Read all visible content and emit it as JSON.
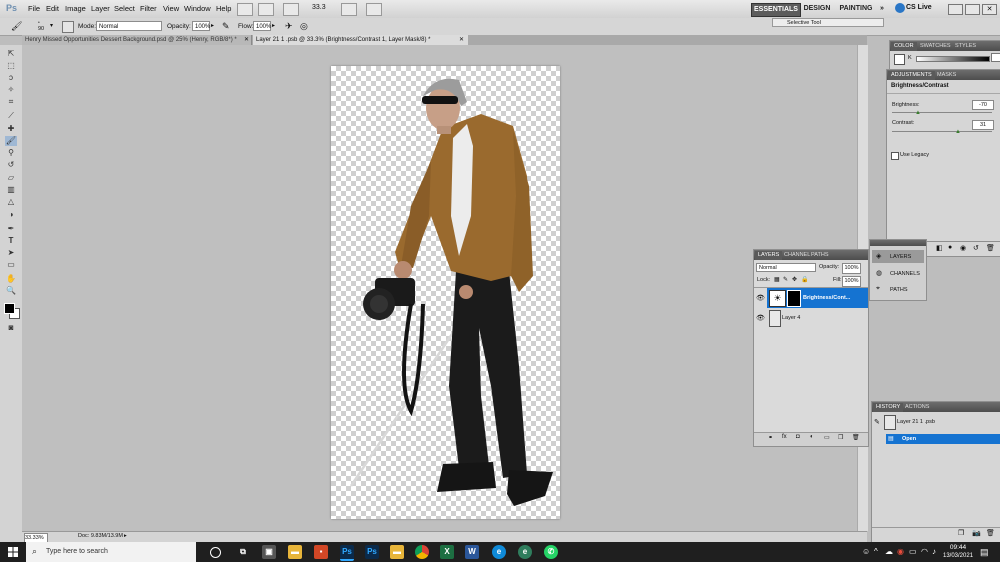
{
  "menubar": {
    "logo": "Ps",
    "menus": [
      "File",
      "Edit",
      "Image",
      "Layer",
      "Select",
      "Filter",
      "View",
      "Window",
      "Help"
    ],
    "zoom": "33.3",
    "workspaces": [
      "ESSENTIALS",
      "DESIGN",
      "PAINTING"
    ],
    "more": "»",
    "cs_live": "CS Live",
    "tooltip": "Selective Tool"
  },
  "options": {
    "brush_size": "90",
    "mode_label": "Mode:",
    "mode_value": "Normal",
    "opacity_label": "Opacity:",
    "opacity_value": "100%",
    "flow_label": "Flow:",
    "flow_value": "100%"
  },
  "tabs": [
    {
      "label": "Henry Missed Opportunities Dessert Background.psd @ 25% (Henry, RGB/8*) *"
    },
    {
      "label": "Layer 21 1 .psb @ 33.3% (Brightness/Contrast 1, Layer Mask/8) *"
    }
  ],
  "status": {
    "zoom": "33.33%",
    "doc": "Doc: 9.83M/13.9M"
  },
  "color_panel": {
    "tabs": [
      "COLOR",
      "SWATCHES",
      "STYLES"
    ],
    "channel": "K"
  },
  "adjustments": {
    "tabs": [
      "ADJUSTMENTS",
      "MASKS"
    ],
    "title": "Brightness/Contrast",
    "brightness_label": "Brightness:",
    "brightness_value": "-70",
    "contrast_label": "Contrast:",
    "contrast_value": "31",
    "legacy_label": "Use Legacy"
  },
  "layers_panel": {
    "tabs": [
      "LAYERS",
      "CHANNEL",
      "PATHS"
    ],
    "blend_mode": "Normal",
    "opacity_label": "Opacity:",
    "opacity_value": "100%",
    "lock_label": "Lock:",
    "fill_label": "Fill:",
    "fill_value": "100%",
    "layers": [
      {
        "name": "Brightness/Cont...",
        "selected": true
      },
      {
        "name": "Layer 4",
        "selected": false
      }
    ]
  },
  "dock": {
    "items": [
      "LAYERS",
      "CHANNELS",
      "PATHS"
    ]
  },
  "history": {
    "tabs": [
      "HISTORY",
      "ACTIONS"
    ],
    "snapshot": "Layer 21 1 .psb",
    "state": "Open"
  },
  "taskbar": {
    "search": "Type here to search",
    "time": "09:44",
    "date": "13/03/2021",
    "apps": [
      "task-view",
      "store",
      "files",
      "office",
      "photoshop",
      "photoshop2",
      "folder",
      "chrome",
      "excel",
      "word",
      "edge",
      "edge-dev",
      "mail",
      "whatsapp"
    ]
  },
  "colors": {
    "accent": "#1573d1",
    "taskbar": "#1f1f1f",
    "jacket": "#9a6a2e"
  }
}
